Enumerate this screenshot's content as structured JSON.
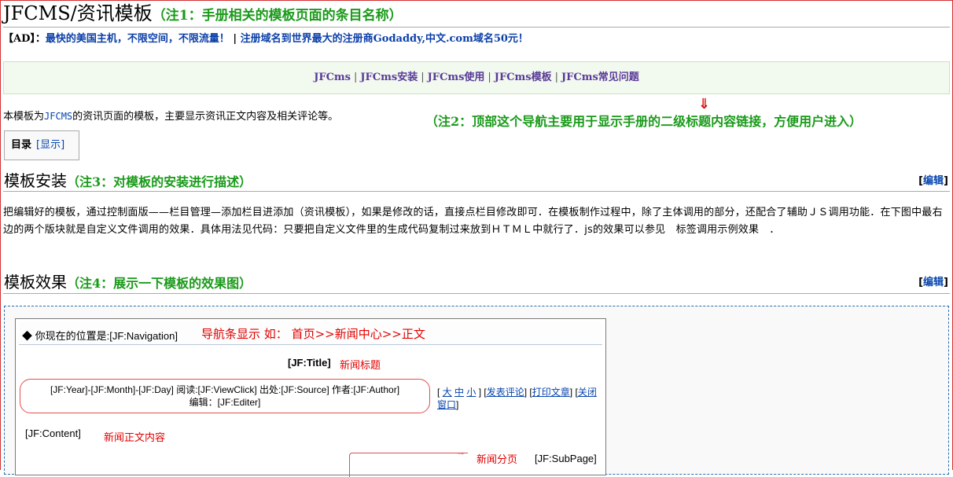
{
  "page": {
    "title": "JFCMS/资讯模板",
    "title_note": "（注1：手册相关的模板页面的条目名称）"
  },
  "ad": {
    "prefix": "【AD】：",
    "link1": "最快的美国主机，不限空间，不限流量！",
    "sep": " | ",
    "link2": "注册域名到世界最大的注册商Godaddy,中文.com域名50元！"
  },
  "nav": {
    "items": [
      "JFCms",
      "JFCms安装",
      "JFCms使用",
      "JFCms模板",
      "JFCms常见问题"
    ],
    "separators": [
      "|",
      "|",
      "|",
      "|"
    ]
  },
  "intro": {
    "before": "本模板为",
    "link": "JFCMS",
    "after": "的资讯页面的模板，主要显示资讯正文内容及相关评论等。"
  },
  "note2": "（注2：顶部这个导航主要用于显示手册的二级标题内容链接，方便用户进入）",
  "toc": {
    "label": "目录",
    "toggle": "[显示]"
  },
  "sections": [
    {
      "heading": "模板安装",
      "note": "（注3：对模板的安装进行描述）",
      "edit_open": "[",
      "edit": "编辑",
      "edit_close": "]",
      "paragraph": "把编辑好的模板，通过控制面版——栏目管理—添加栏目进添加（资讯模板），如果是修改的话，直接点栏目修改即可．在模板制作过程中，除了主体调用的部分，还配合了辅助ＪＳ调用功能．在下图中最右边的两个版块就是自定义文件调用的效果．具体用法见代码：只要把自定义文件里的生成代码复制过来放到ＨＴＭＬ中就行了．js的效果可以参见　标签调用示例效果　．"
    },
    {
      "heading": "模板效果",
      "note": "（注4：展示一下模板的效果图）",
      "edit_open": "[",
      "edit": "编辑",
      "edit_close": "]"
    }
  ],
  "preview": {
    "position": "◆ 你现在的位置是:[JF:Navigation]",
    "nav_hint_a": "导航条显示 如：",
    "nav_hint_b": "首页>>新闻中心>>正文",
    "jtitle": "[JF:Title]",
    "jtitle_note": "新闻标题",
    "meta_line1": "[JF:Year]-[JF:Month]-[JF:Day] 阅读:[JF:ViewClick]  出处:[JF:Source] 作者:[JF:Author]",
    "meta_line2": "编辑：[JF:Editer]",
    "tools": {
      "open": "[ ",
      "big": "大",
      "mid": "中",
      "small": "小",
      "mid_sep": " ] [",
      "comment": "发表评论",
      "s1": "] [",
      "print": "打印文章",
      "s2": "] [",
      "close": "关闭窗口",
      "end": "]"
    },
    "content": "[JF:Content]",
    "content_note": "新闻正文内容",
    "sub_note": "新闻分页",
    "sub": "[JF:SubPage]"
  },
  "colors": {
    "note": "#1a9a1a",
    "link": "#0645ad",
    "annotation": "#e00000",
    "nav_bg": "#f2f9ee"
  }
}
